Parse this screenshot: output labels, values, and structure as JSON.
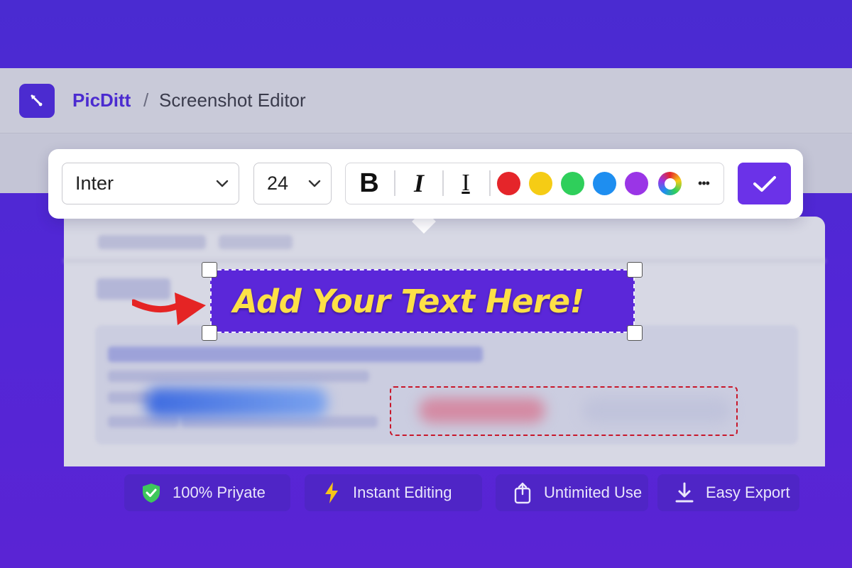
{
  "app": {
    "brand": "PicDitt",
    "separator": "/",
    "breadcrumb": "Screenshot Editor",
    "logo_icon": "picker-icon"
  },
  "toolbar": {
    "font_family": "Inter",
    "font_size": "24",
    "bold_label": "B",
    "italic_label": "I",
    "text_style_label": "I",
    "colors": [
      {
        "name": "red",
        "hex": "#e5252a"
      },
      {
        "name": "yellow",
        "hex": "#f5cc15"
      },
      {
        "name": "green",
        "hex": "#2fcf5b"
      },
      {
        "name": "blue",
        "hex": "#1e8ef0"
      },
      {
        "name": "purple",
        "hex": "#9a35e6"
      }
    ],
    "more_label": "•••",
    "confirm_icon": "check-icon"
  },
  "editor": {
    "text_box": "Add Your Text Here!",
    "text_color": "#fde047",
    "box_color": "#5b27d9"
  },
  "features": [
    {
      "label": "100% Priyate",
      "icon": "shield-check-icon"
    },
    {
      "label": "Instant Editing",
      "icon": "lightning-icon"
    },
    {
      "label": "Untimited Use",
      "icon": "share-icon"
    },
    {
      "label": "Easy Export",
      "icon": "download-icon"
    }
  ]
}
